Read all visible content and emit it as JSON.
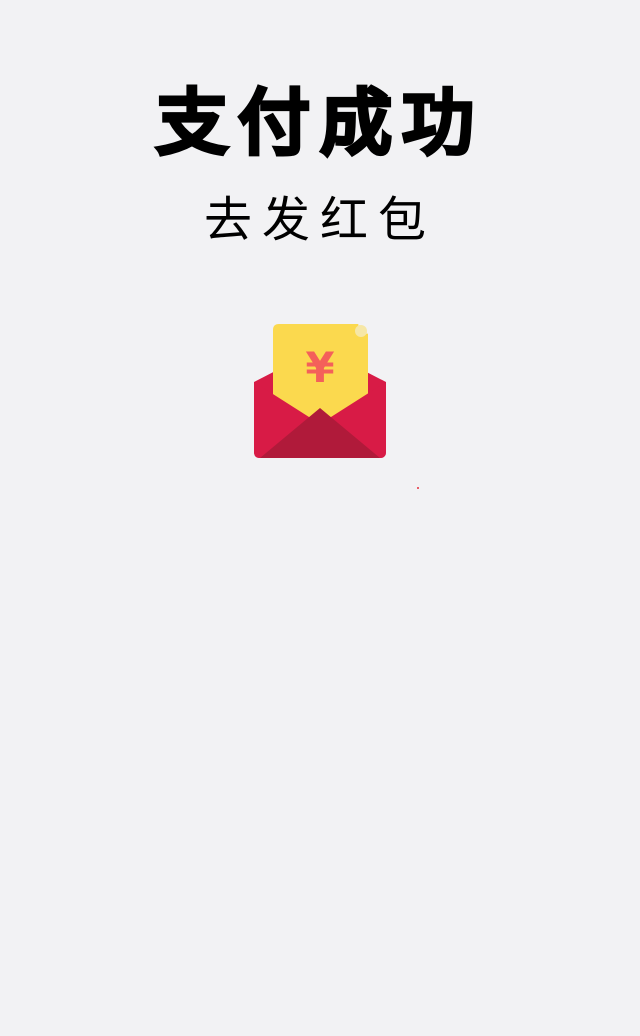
{
  "header": {
    "title": "支付成功",
    "subtitle": "去发红包"
  },
  "red_packet": {
    "icon": "red-envelope-icon",
    "currency_symbol": "¥",
    "colors": {
      "envelope": "#d81b46",
      "envelope_dark": "#b01a3a",
      "card": "#fbd94e",
      "symbol": "#f4605a"
    }
  }
}
